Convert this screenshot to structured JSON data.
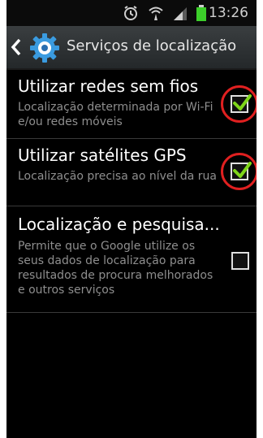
{
  "status_bar": {
    "time": "13:26",
    "icons": [
      "alarm-icon",
      "wifi-icon",
      "signal-icon",
      "battery-icon"
    ]
  },
  "action_bar": {
    "title": "Serviços de localização",
    "icons": [
      "back-chevron-icon",
      "settings-gear-icon"
    ]
  },
  "settings": [
    {
      "title": "Utilizar redes sem fios",
      "subtitle": "Localização determinada por Wi-Fi e/ou redes móveis",
      "checked": true,
      "highlighted": true
    },
    {
      "title": "Utilizar satélites GPS",
      "subtitle": "Localização precisa ao nível da rua",
      "checked": true,
      "highlighted": true
    },
    {
      "title": "Localização e pesquisa...",
      "subtitle": "Permite que o Google utilize os seus dados de localização para resultados de procura melhorados e outros serviços",
      "checked": false,
      "highlighted": false
    }
  ],
  "colors": {
    "checkmark": "#7fd61a",
    "highlight_circle": "#e02020",
    "title_text": "#ffffff",
    "subtitle_text": "#8e8e8e"
  }
}
